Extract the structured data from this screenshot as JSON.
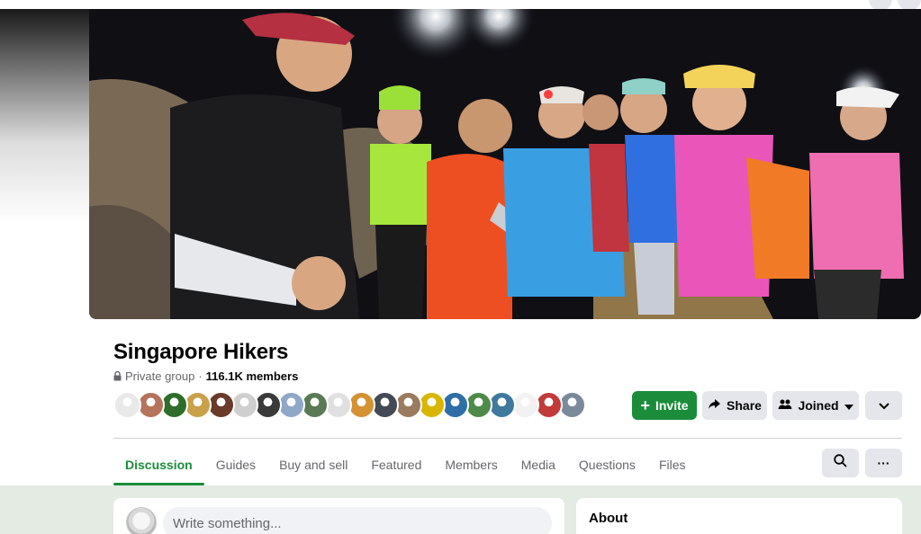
{
  "group": {
    "name": "Singapore Hikers",
    "privacy": "Private group",
    "separator": "·",
    "members": "116.1K members"
  },
  "avatar_colors": [
    "#e9e9e9",
    "#b5735b",
    "#2f6d2b",
    "#c9a14a",
    "#6a3b2a",
    "#cfcfcf",
    "#3a3a3a",
    "#8fa8c8",
    "#5a7a55",
    "#e0e0e0",
    "#d49232",
    "#444a55",
    "#9a7b5f",
    "#d8b600",
    "#2e6fa8",
    "#4e8a4a",
    "#3f7a9e",
    "#f2f2f2",
    "#c23b3b",
    "#7a8a9a"
  ],
  "actions": {
    "invite": "Invite",
    "share": "Share",
    "joined": "Joined"
  },
  "tabs": [
    {
      "label": "Discussion",
      "active": true
    },
    {
      "label": "Guides"
    },
    {
      "label": "Buy and sell"
    },
    {
      "label": "Featured"
    },
    {
      "label": "Members"
    },
    {
      "label": "Media"
    },
    {
      "label": "Questions"
    },
    {
      "label": "Files"
    }
  ],
  "tab_more": "···",
  "composer": {
    "placeholder": "Write something..."
  },
  "about": {
    "title": "About"
  },
  "colors": {
    "accent": "#1b8d3a",
    "button_grey": "#e4e6eb",
    "muted_text": "#65676b"
  },
  "icons": {
    "invite": "plus-icon",
    "share": "share-arrow-icon",
    "joined": "people-icon",
    "search": "search-icon",
    "lock": "lock-icon",
    "more": "more-dots-icon",
    "chevron": "chevron-down-icon"
  }
}
